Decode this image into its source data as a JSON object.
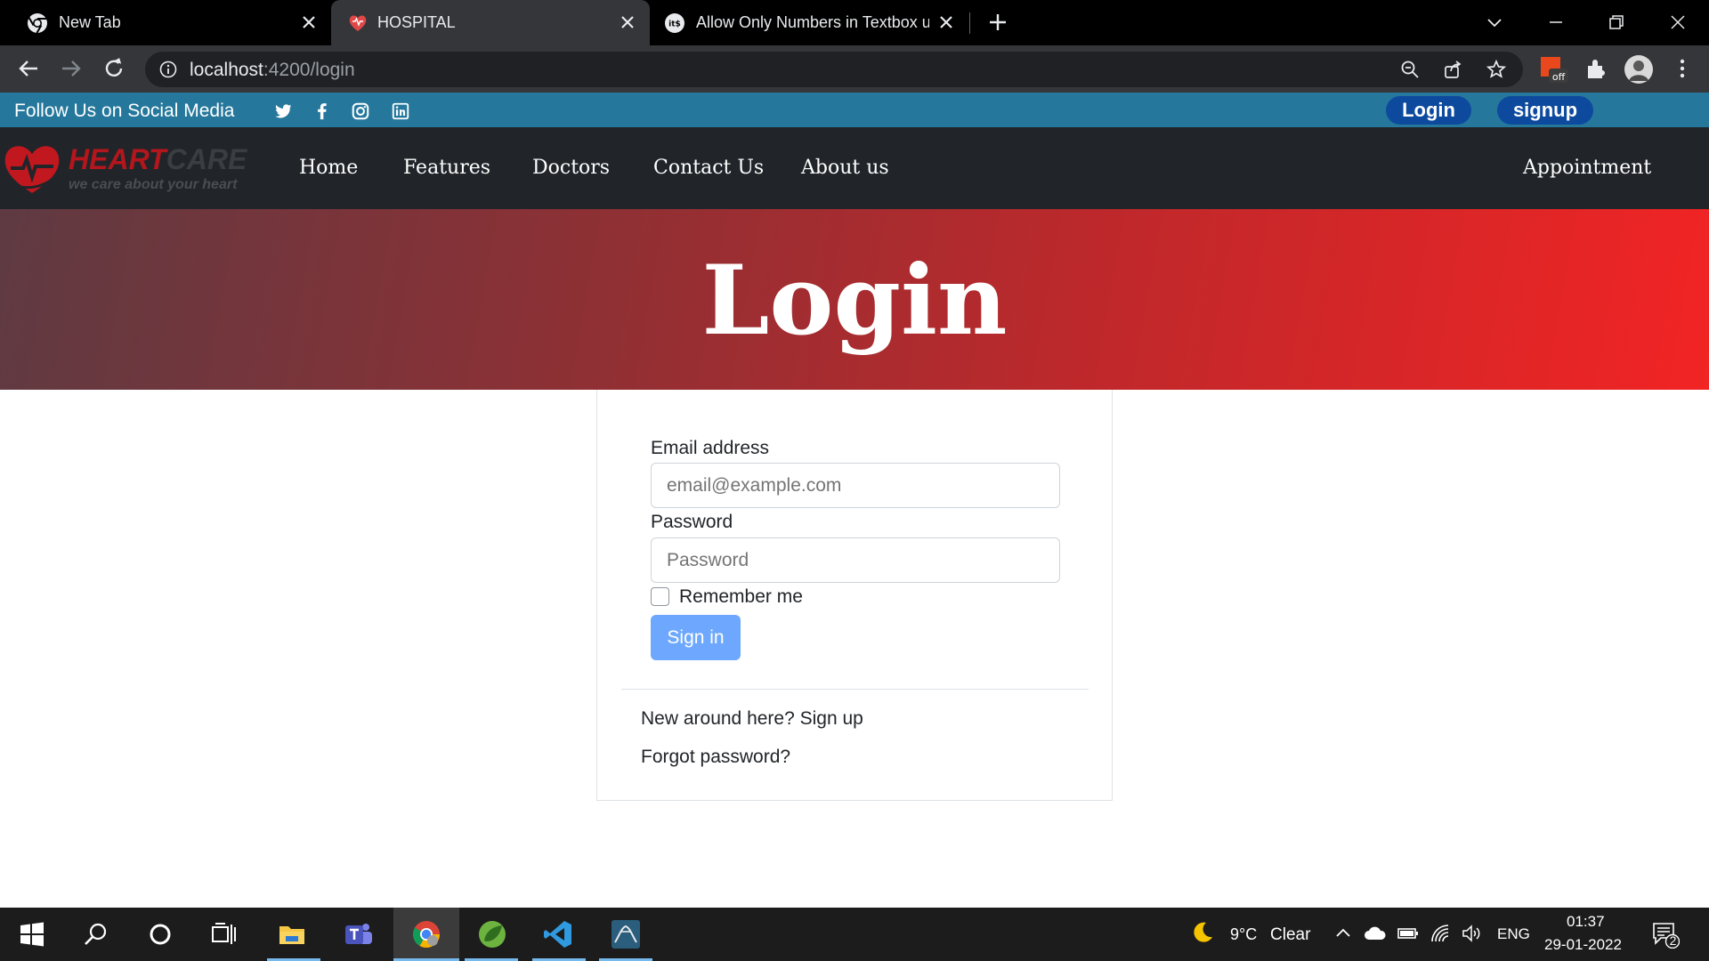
{
  "browser": {
    "tabs": [
      {
        "title": "New Tab"
      },
      {
        "title": "HOSPITAL"
      },
      {
        "title": "Allow Only Numbers in Textbox u"
      }
    ],
    "url_host": "localhost",
    "url_path": ":4200/login"
  },
  "page": {
    "topbar": {
      "follow_text": "Follow Us on Social Media",
      "social_icons": [
        "twitter-icon",
        "facebook-icon",
        "instagram-icon",
        "linkedin-icon"
      ],
      "login_label": "Login",
      "signup_label": "signup"
    },
    "brand": {
      "name_part1": "HEART",
      "name_part2": "CARE",
      "tagline": "we care about your heart"
    },
    "nav": {
      "items": [
        "Home",
        "Features",
        "Doctors",
        "Contact Us",
        "About us"
      ],
      "appointment": "Appointment"
    },
    "hero": {
      "title": "Login"
    },
    "form": {
      "email_label": "Email address",
      "email_placeholder": "email@example.com",
      "password_label": "Password",
      "password_placeholder": "Password",
      "remember_label": "Remember me",
      "signin_label": "Sign in",
      "signup_link": "New around here? Sign up",
      "forgot_link": "Forgot password?"
    },
    "colors": {
      "topbar": "#25789c",
      "navbar": "#212529",
      "hero_start": "#5f3a42",
      "hero_end": "#f22424",
      "signin_button": "#6ea8fe",
      "pill": "#0d4a9e"
    }
  },
  "taskbar": {
    "weather_temp": "9°C",
    "weather_text": "Clear",
    "language": "ENG",
    "time": "01:37",
    "date": "29-01-2022",
    "notifications": "2"
  }
}
